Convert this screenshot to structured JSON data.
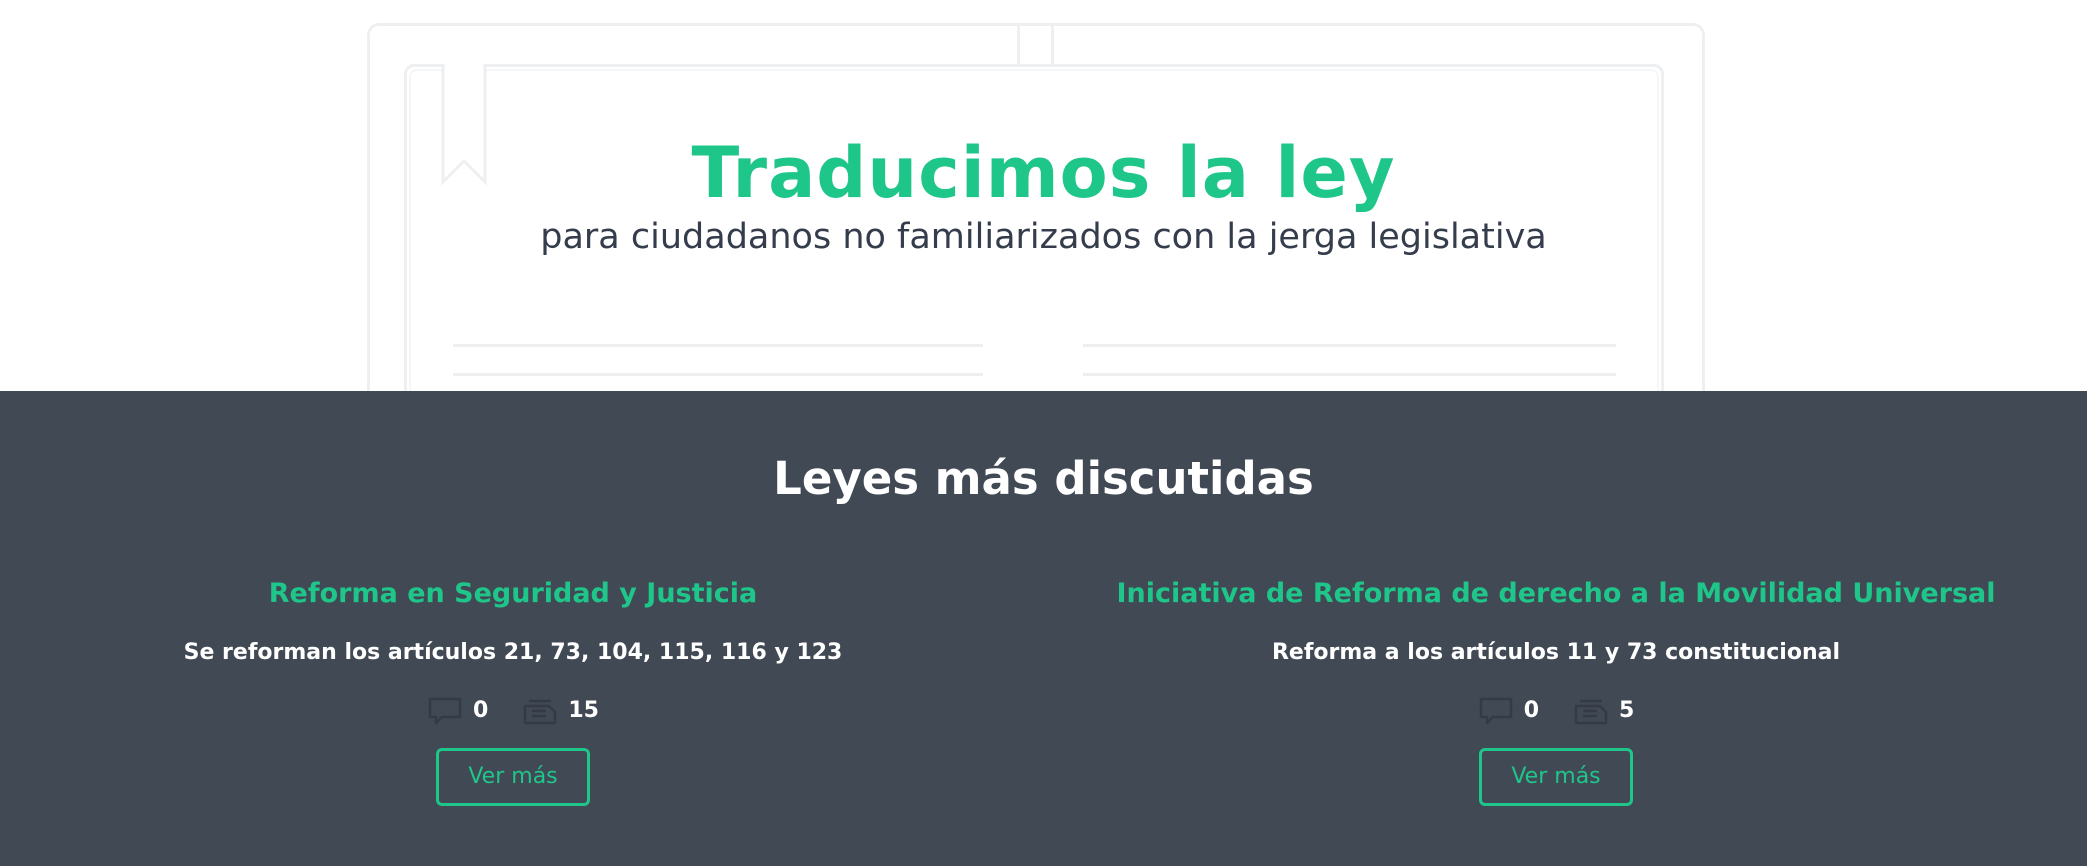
{
  "hero": {
    "title": "Traducimos la ley",
    "subtitle": "para ciudadanos no familiarizados con la jerga legislativa"
  },
  "discussed": {
    "section_title": "Leyes más discutidas",
    "laws": [
      {
        "title": "Reforma en Seguridad y Justicia",
        "description": "Se reforman los artículos 21, 73, 104, 115, 116 y 123",
        "comments": "0",
        "proposals": "15",
        "button_label": "Ver más"
      },
      {
        "title": "Iniciativa de Reforma de derecho a la Movilidad Universal",
        "description": "Reforma a los artículos 11 y 73 constitucional",
        "comments": "0",
        "proposals": "5",
        "button_label": "Ver más"
      }
    ]
  },
  "icons": {
    "comment": "speech-bubble-icon",
    "proposal": "document-stack-icon",
    "bookmark": "bookmark-ribbon-icon"
  },
  "colors": {
    "accent": "#1fc68a",
    "dark_section": "#414955",
    "subtitle_text": "#353d4d",
    "book_outline": "#eeeff1",
    "icon_muted": "#343b45"
  }
}
